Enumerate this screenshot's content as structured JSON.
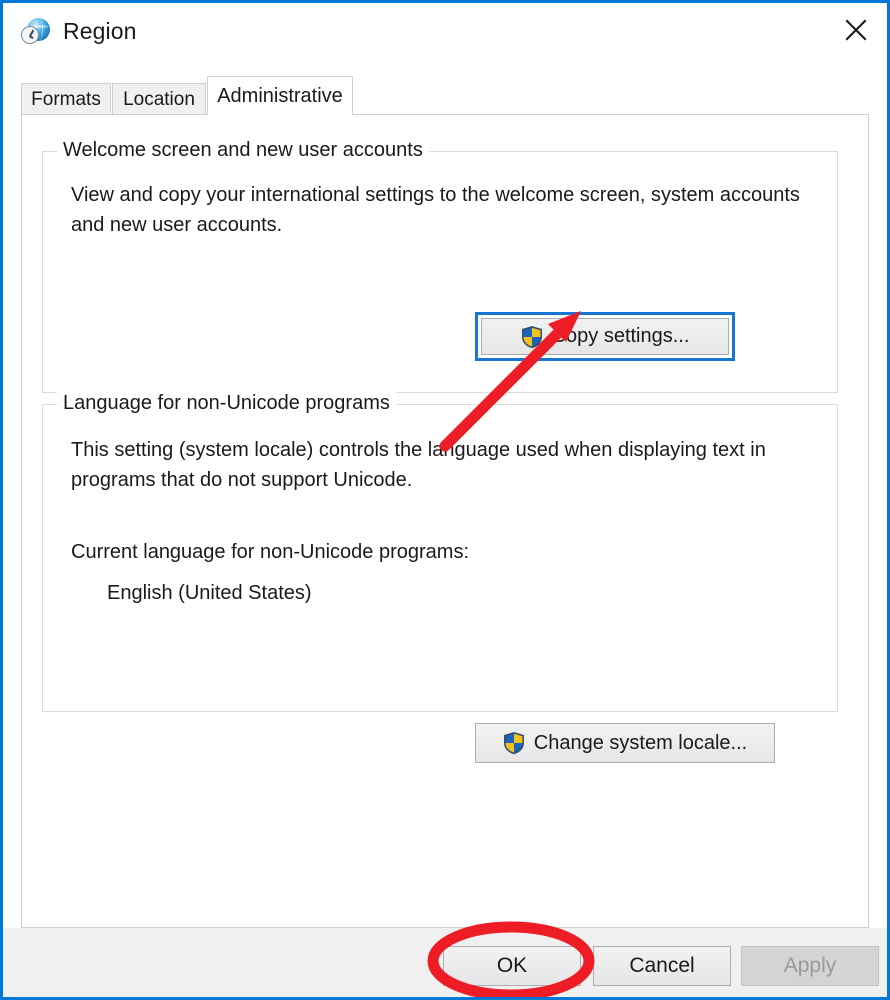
{
  "window": {
    "title": "Region",
    "icon": "region-globe-clock-icon",
    "close_label": "✕",
    "border_color": "#0078d7"
  },
  "tabs": [
    {
      "label": "Formats",
      "active": false
    },
    {
      "label": "Location",
      "active": false
    },
    {
      "label": "Administrative",
      "active": true
    }
  ],
  "groups": {
    "welcome": {
      "legend": "Welcome screen and new user accounts",
      "description": "View and copy your international settings to the welcome screen, system accounts and new user accounts.",
      "button": {
        "label": "Copy settings...",
        "icon": "uac-shield-icon",
        "focused": true,
        "focus_color": "#1877d2"
      }
    },
    "language": {
      "legend": "Language for non-Unicode programs",
      "description": "This setting (system locale) controls the language used when displaying text in programs that do not support Unicode.",
      "current_label": "Current language for non-Unicode programs:",
      "current_value": "English (United States)",
      "button": {
        "label": "Change system locale...",
        "icon": "uac-shield-icon"
      }
    }
  },
  "footer": {
    "ok_label": "OK",
    "cancel_label": "Cancel",
    "apply_label": "Apply",
    "apply_disabled": true
  },
  "annotations": {
    "arrow_color": "#ee1c25",
    "ellipse_color": "#ee1c25",
    "arrow_target": "copy-settings-button",
    "ellipse_target": "ok-button"
  }
}
